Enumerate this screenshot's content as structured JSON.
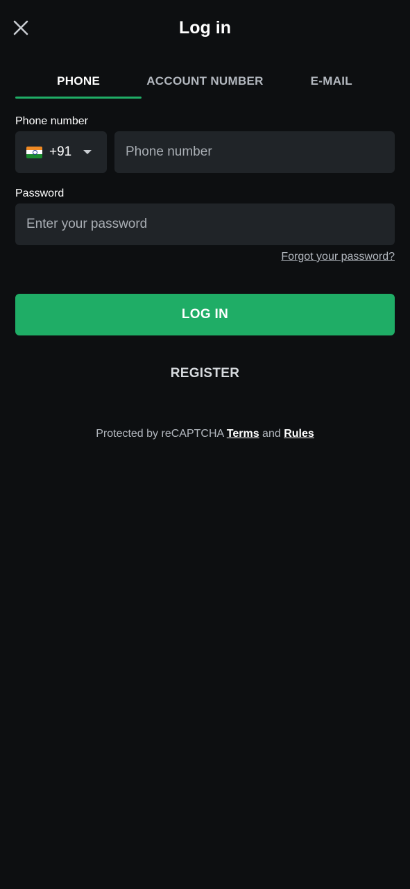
{
  "header": {
    "title": "Log in",
    "close_icon": "close-icon"
  },
  "tabs": [
    {
      "label": "PHONE",
      "active": true
    },
    {
      "label": "ACCOUNT NUMBER",
      "active": false
    },
    {
      "label": "E-MAIL",
      "active": false
    }
  ],
  "phone": {
    "label": "Phone number",
    "country_flag_icon": "india-flag-icon",
    "country_code": "+91",
    "placeholder": "Phone number",
    "value": ""
  },
  "password": {
    "label": "Password",
    "placeholder": "Enter your password",
    "value": "",
    "forgot_link": "Forgot your password?"
  },
  "actions": {
    "login_label": "LOG IN",
    "register_label": "REGISTER"
  },
  "footer": {
    "protected_text": "Protected by reCAPTCHA",
    "terms_link": "Terms",
    "and_text": "and",
    "rules_link": "Rules"
  },
  "colors": {
    "background": "#0d0f11",
    "field": "#202428",
    "accent": "#1fad66",
    "muted_text": "#b3b8bf"
  }
}
